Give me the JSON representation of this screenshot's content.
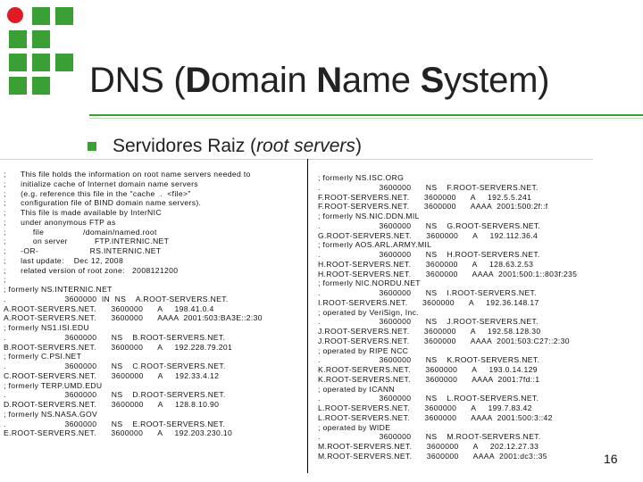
{
  "slide": {
    "title_parts": [
      {
        "text": "DNS (",
        "bold": false
      },
      {
        "text": "D",
        "bold": true
      },
      {
        "text": "omain ",
        "bold": false
      },
      {
        "text": "N",
        "bold": true
      },
      {
        "text": "ame ",
        "bold": false
      },
      {
        "text": "S",
        "bold": true
      },
      {
        "text": "ystem)",
        "bold": false
      }
    ],
    "bullet": {
      "text_before": "Servidores Raiz (",
      "text_italic": "root servers",
      "text_after": ")"
    },
    "page_number": "16",
    "colors": {
      "accent_green": "#3aa035",
      "accent_red": "#e01b24"
    }
  },
  "left_column": [
    ";      This file holds the information on root name servers needed to",
    ";      initialize cache of Internet domain name servers",
    ";      (e.g. reference this file in the \"cache  .  <file>\"",
    ";      configuration file of BIND domain name servers).",
    ";      This file is made available by InterNIC",
    ";      under anonymous FTP as",
    ";           file                /domain/named.root",
    ";           on server           FTP.INTERNIC.NET",
    ";      -OR-                     RS.INTERNIC.NET",
    ";      last update:    Dec 12, 2008",
    ";      related version of root zone:   2008121200",
    ";",
    "; formerly NS.INTERNIC.NET",
    ".                        3600000  IN  NS    A.ROOT-SERVERS.NET.",
    "A.ROOT-SERVERS.NET.      3600000      A     198.41.0.4",
    "A.ROOT-SERVERS.NET.      3600000      AAAA  2001:503:BA3E::2:30",
    "; formerly NS1.ISI.EDU",
    ".                        3600000      NS    B.ROOT-SERVERS.NET.",
    "B.ROOT-SERVERS.NET.      3600000      A     192.228.79.201",
    "; formerly C.PSI.NET",
    ".                        3600000      NS    C.ROOT-SERVERS.NET.",
    "C.ROOT-SERVERS.NET.      3600000      A     192.33.4.12",
    "; formerly TERP.UMD.EDU",
    ".                        3600000      NS    D.ROOT-SERVERS.NET.",
    "D.ROOT-SERVERS.NET.      3600000      A     128.8.10.90",
    "; formerly NS.NASA.GOV",
    ".                        3600000      NS    E.ROOT-SERVERS.NET.",
    "E.ROOT-SERVERS.NET.      3600000      A     192.203.230.10"
  ],
  "right_column": [
    "; formerly NS.ISC.ORG",
    ".                        3600000      NS    F.ROOT-SERVERS.NET.",
    "F.ROOT-SERVERS.NET.      3600000      A     192.5.5.241",
    "F.ROOT-SERVERS.NET.      3600000      AAAA  2001:500:2f::f",
    "; formerly NS.NIC.DDN.MIL",
    ".                        3600000      NS    G.ROOT-SERVERS.NET.",
    "G.ROOT-SERVERS.NET.      3600000      A     192.112.36.4",
    "; formerly AOS.ARL.ARMY.MIL",
    ".                        3600000      NS    H.ROOT-SERVERS.NET.",
    "H.ROOT-SERVERS.NET.      3600000      A     128.63.2.53",
    "H.ROOT-SERVERS.NET.      3600000      AAAA  2001:500:1::803f:235",
    "; formerly NIC.NORDU.NET",
    ".                        3600000      NS    I.ROOT-SERVERS.NET.",
    "I.ROOT-SERVERS.NET.      3600000      A     192.36.148.17",
    "; operated by VeriSign, Inc.",
    ".                        3600000      NS    J.ROOT-SERVERS.NET.",
    "J.ROOT-SERVERS.NET.      3600000      A     192.58.128.30",
    "J.ROOT-SERVERS.NET.      3600000      AAAA  2001:503:C27::2:30",
    "; operated by RIPE NCC",
    ".                        3600000      NS    K.ROOT-SERVERS.NET.",
    "K.ROOT-SERVERS.NET.      3600000      A     193.0.14.129",
    "K.ROOT-SERVERS.NET.      3600000      AAAA  2001:7fd::1",
    "; operated by ICANN",
    ".                        3600000      NS    L.ROOT-SERVERS.NET.",
    "L.ROOT-SERVERS.NET.      3600000      A     199.7.83.42",
    "L.ROOT-SERVERS.NET.      3600000      AAAA  2001:500:3::42",
    "; operated by WIDE",
    ".                        3600000      NS    M.ROOT-SERVERS.NET.",
    "M.ROOT-SERVERS.NET.      3600000      A     202.12.27.33",
    "M.ROOT-SERVERS.NET.      3600000      AAAA  2001:dc3::35"
  ]
}
